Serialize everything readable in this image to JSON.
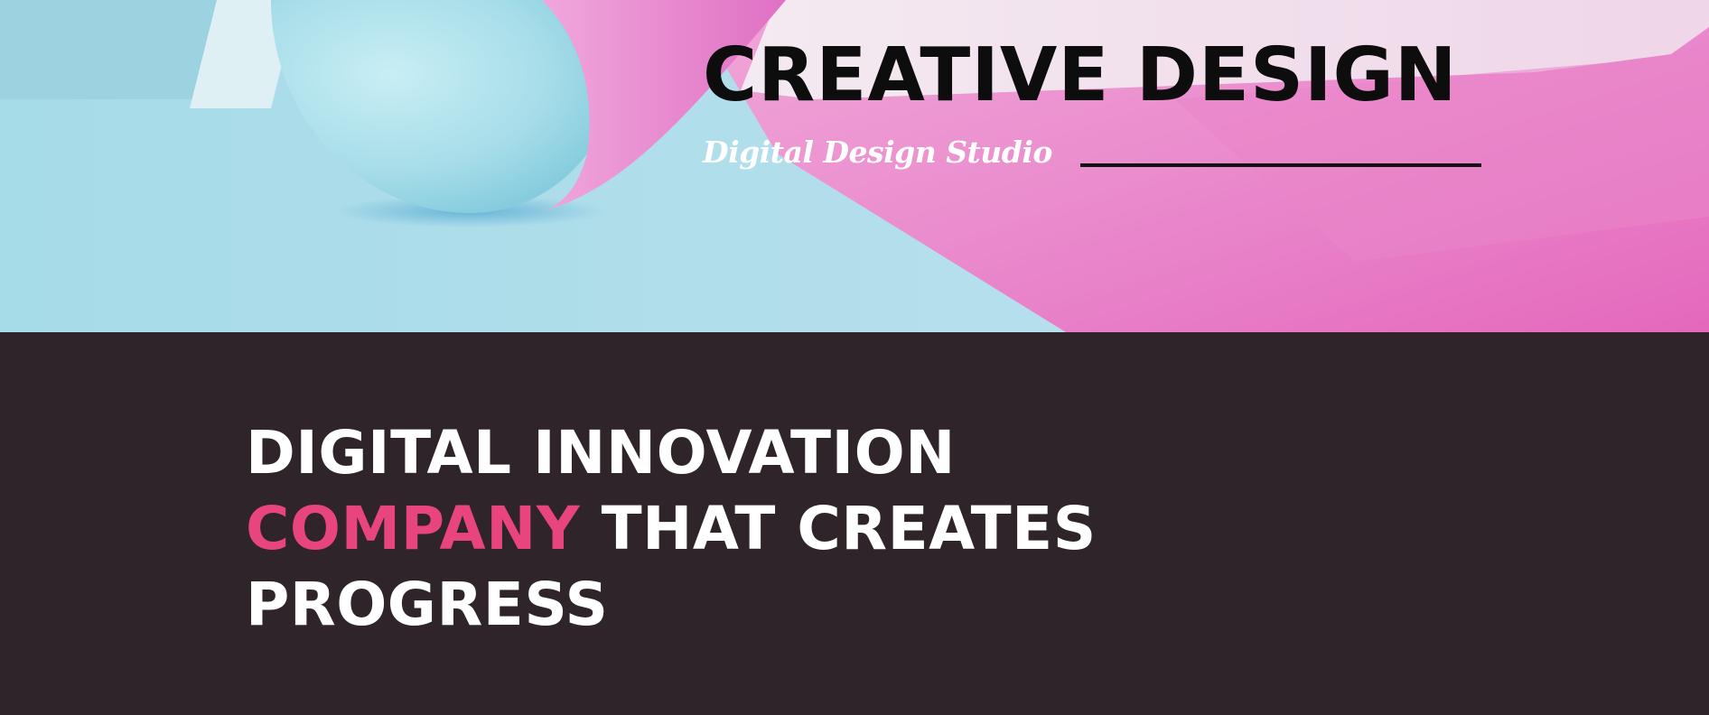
{
  "hero": {
    "title": "CREATIVE DESIGN",
    "subtitle": "Digital Design Studio",
    "background_image": "abstract-3d-sphere-and-planes",
    "colors": {
      "cyan": "#a9dde8",
      "pink": "#e777c3",
      "title": "#0d0d0d",
      "subtitle": "#ffffff"
    }
  },
  "main": {
    "headline": {
      "line1": "DIGITAL INNOVATION",
      "line2_accent": "COMPANY",
      "line2_rest": " THAT CREATES",
      "line3": "PROGRESS"
    },
    "colors": {
      "background": "#2e2429",
      "text": "#ffffff",
      "accent": "#e8457f"
    }
  }
}
